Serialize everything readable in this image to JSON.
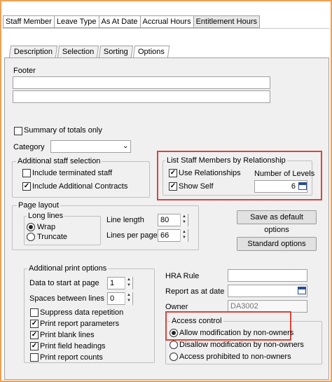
{
  "columns": [
    "Staff Member",
    "Leave Type",
    "As At Date",
    "Accrual Hours",
    "Entitlement Hours"
  ],
  "tabs": [
    {
      "label": "Description",
      "active": false
    },
    {
      "label": "Selection",
      "active": false
    },
    {
      "label": "Sorting",
      "active": false
    },
    {
      "label": "Options",
      "active": true
    }
  ],
  "footer": {
    "label": "Footer",
    "line1": "",
    "line2": ""
  },
  "summary_totals": {
    "label": "Summary of totals only",
    "checked": false
  },
  "category": {
    "label": "Category",
    "value": ""
  },
  "additional_staff": {
    "title": "Additional staff selection",
    "include_terminated": {
      "label": "Include terminated staff",
      "checked": false
    },
    "include_additional": {
      "label": "Include Additional Contracts",
      "checked": true
    }
  },
  "relationship": {
    "title": "List Staff Members by Relationship",
    "use_relationships": {
      "label": "Use Relationships",
      "checked": true
    },
    "show_self": {
      "label": "Show Self",
      "checked": true
    },
    "levels_label": "Number of Levels",
    "levels_value": "6"
  },
  "page_layout": {
    "title": "Page layout",
    "long_lines": "Long lines",
    "wrap": "Wrap",
    "truncate": "Truncate",
    "line_length_label": "Line length",
    "line_length_value": "80",
    "lines_per_page_label": "Lines per page",
    "lines_per_page_value": "66"
  },
  "buttons": {
    "save_default": "Save as default options",
    "standard": "Standard options"
  },
  "print_options": {
    "title": "Additional print options",
    "start_page_label": "Data to start at page",
    "start_page_value": "1",
    "spaces_label": "Spaces between lines",
    "spaces_value": "0",
    "suppress": {
      "label": "Suppress data repetition",
      "checked": false
    },
    "params": {
      "label": "Print report parameters",
      "checked": true
    },
    "blank": {
      "label": "Print blank lines",
      "checked": true
    },
    "headings": {
      "label": "Print field headings",
      "checked": true
    },
    "counts": {
      "label": "Print report counts",
      "checked": false
    }
  },
  "hra": {
    "hra_rule_label": "HRA Rule",
    "hra_rule_value": "",
    "report_date_label": "Report as at date",
    "report_date_value": "",
    "owner_label": "Owner",
    "owner_value": "DA3002"
  },
  "access": {
    "title": "Access control",
    "allow": "Allow modification by non-owners",
    "disallow": "Disallow modification by non-owners",
    "prohibited": "Access prohibited to non-owners",
    "selected": "allow"
  },
  "colors": {
    "highlight": "#d9443c",
    "frame": "#f0a050"
  }
}
